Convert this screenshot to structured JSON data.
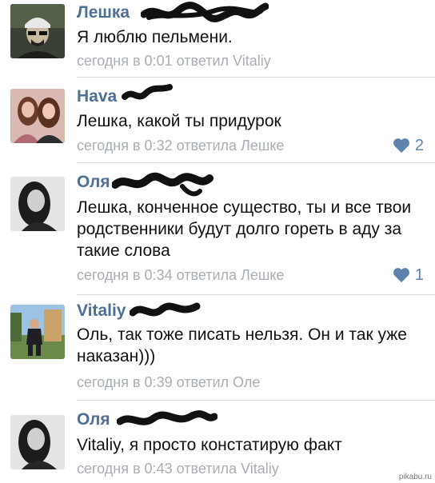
{
  "comments": [
    {
      "author": "Лешка",
      "text": "Я люблю пельмени.",
      "time": "сегодня в 0:01",
      "reply": "ответил Vitaliy",
      "likes": null,
      "avatar_icon": "man-cap-avatar-icon"
    },
    {
      "author": "Hava",
      "text": "Лешка, какой ты придурок",
      "time": "сегодня в 0:32",
      "reply": "ответила Лешке",
      "likes": "2",
      "avatar_icon": "girls-photo-avatar-icon"
    },
    {
      "author": "Оля",
      "text": "Лешка, конченное существо, ты и все твои родственники будут долго гореть в аду за такие слова",
      "time": "сегодня в 0:34",
      "reply": "ответила Лешке",
      "likes": "1",
      "avatar_icon": "girl-photo-avatar-icon"
    },
    {
      "author": "Vitaliy",
      "text": "Оль, так тоже писать нельзя. Он и так уже наказан)))",
      "time": "сегодня в 0:39",
      "reply": "ответил Оле",
      "likes": null,
      "avatar_icon": "guy-outdoor-avatar-icon"
    },
    {
      "author": "Оля",
      "text": "Vitaliy, я просто констатирую факт",
      "time": "сегодня в 0:43",
      "reply": "ответила Vitaliy",
      "likes": null,
      "avatar_icon": "girl-photo-avatar-icon"
    }
  ],
  "watermark": "pikabu.ru",
  "colors": {
    "name": "#4e6f96",
    "meta": "#a9aeb6",
    "like": "#5d83ad",
    "text": "#111111"
  }
}
